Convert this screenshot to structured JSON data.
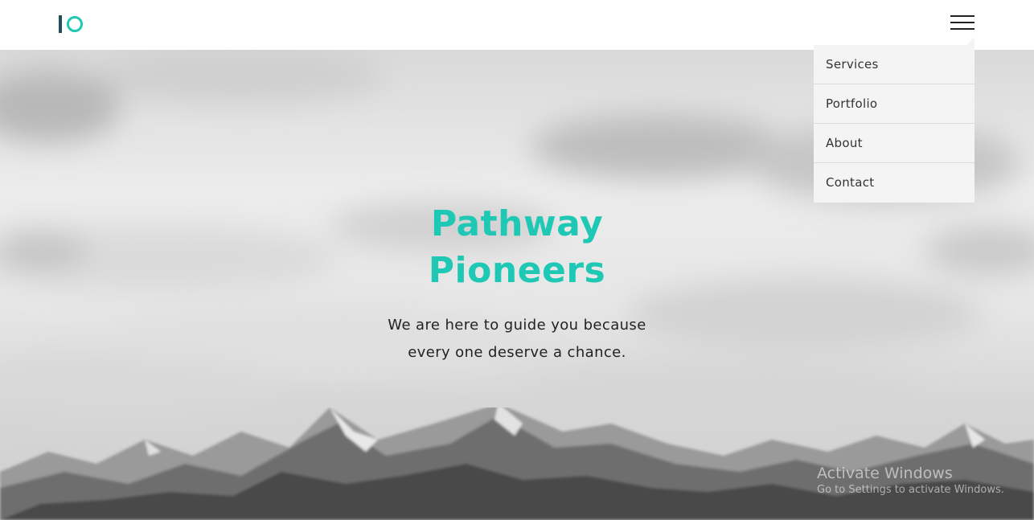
{
  "brand": {
    "logo_icon": "io-logo"
  },
  "nav": {
    "menu_icon": "hamburger-menu-icon",
    "items": [
      {
        "label": "Services"
      },
      {
        "label": "Portfolio"
      },
      {
        "label": "About"
      },
      {
        "label": "Contact"
      }
    ]
  },
  "hero": {
    "title_line1": "Pathway",
    "title_line2": "Pioneers",
    "subtitle_line1": "We are here to guide you because",
    "subtitle_line2": "every one deserve a chance."
  },
  "watermark": {
    "title": "Activate Windows",
    "subtitle": "Go to Settings to activate Windows."
  },
  "colors": {
    "accent": "#1ec8b4",
    "logo_dark": "#1f4f5a",
    "menu_bg": "#f4f4f4",
    "text": "#222222"
  }
}
